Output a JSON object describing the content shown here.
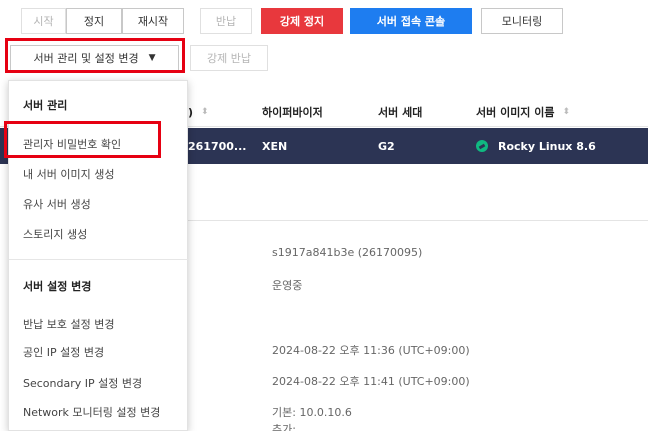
{
  "toolbar": {
    "start": "시작",
    "stop": "정지",
    "restart": "재시작",
    "return": "반납",
    "force_stop": "강제 정지",
    "console": "서버 접속 콘솔",
    "monitoring": "모니터링",
    "manage_dropdown": "서버 관리 및 설정 변경",
    "force_return": "강제 반납"
  },
  "table": {
    "headers": [
      ")",
      "하이퍼바이저",
      "서버 세대",
      "서버 이미지 이름"
    ],
    "selected_row": {
      "id": "261700...",
      "hypervisor": "XEN",
      "generation": "G2",
      "image": "Rocky Linux 8.6"
    }
  },
  "details": [
    "s1917a841b3e (26170095)",
    "운영중",
    "2024-08-22 오후 11:36 (UTC+09:00)",
    "2024-08-22 오후 11:41 (UTC+09:00)",
    "기본: 10.0.10.6",
    "추가:"
  ],
  "menu": {
    "section1": "서버 관리",
    "items1": [
      "관리자 비밀번호 확인",
      "내 서버 이미지 생성",
      "유사 서버 생성",
      "스토리지 생성"
    ],
    "section2": "서버 설정 변경",
    "items2": [
      "반납 보호 설정 변경",
      "공인 IP 설정 변경",
      "Secondary IP 설정 변경",
      "Network 모니터링 설정 변경"
    ]
  },
  "colors": {
    "highlight": "#e60012",
    "danger": "#e8383d",
    "primary": "#1e7df0",
    "selected_row": "#2c3454"
  }
}
